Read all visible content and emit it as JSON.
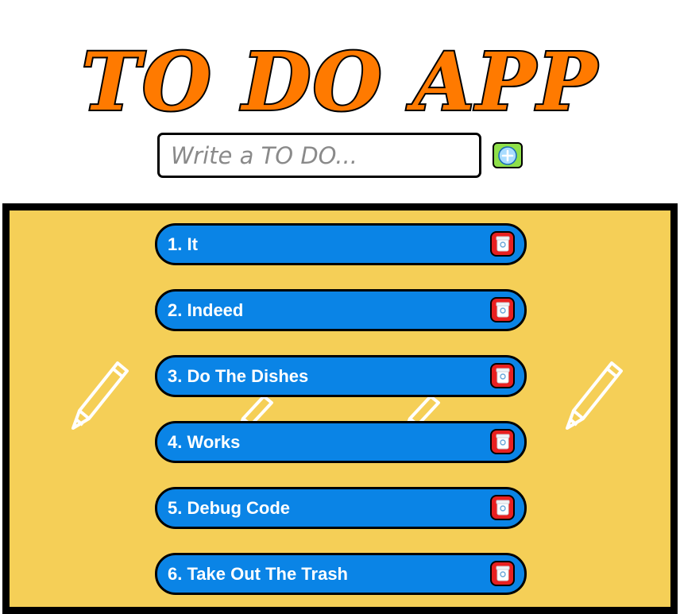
{
  "header": {
    "title": "TO DO APP"
  },
  "form": {
    "input_placeholder": "Write a TO DO...",
    "input_value": "",
    "add_icon": "plus-circle-icon"
  },
  "todos": [
    {
      "label": "1. It",
      "delete_icon": "trash-icon"
    },
    {
      "label": "2. Indeed",
      "delete_icon": "trash-icon"
    },
    {
      "label": "3. Do The Dishes",
      "delete_icon": "trash-icon"
    },
    {
      "label": "4. Works",
      "delete_icon": "trash-icon"
    },
    {
      "label": "5. Debug Code",
      "delete_icon": "trash-icon"
    },
    {
      "label": "6. Take Out The Trash",
      "delete_icon": "trash-icon"
    }
  ],
  "colors": {
    "title_fill": "#ff7a00",
    "title_stroke": "#000000",
    "board_background": "#f5cf57",
    "item_background": "#0a84e6",
    "item_text": "#ffffff",
    "add_button": "#8fe04a",
    "delete_button": "#e82020"
  },
  "background_decoration": "pencil-icon"
}
